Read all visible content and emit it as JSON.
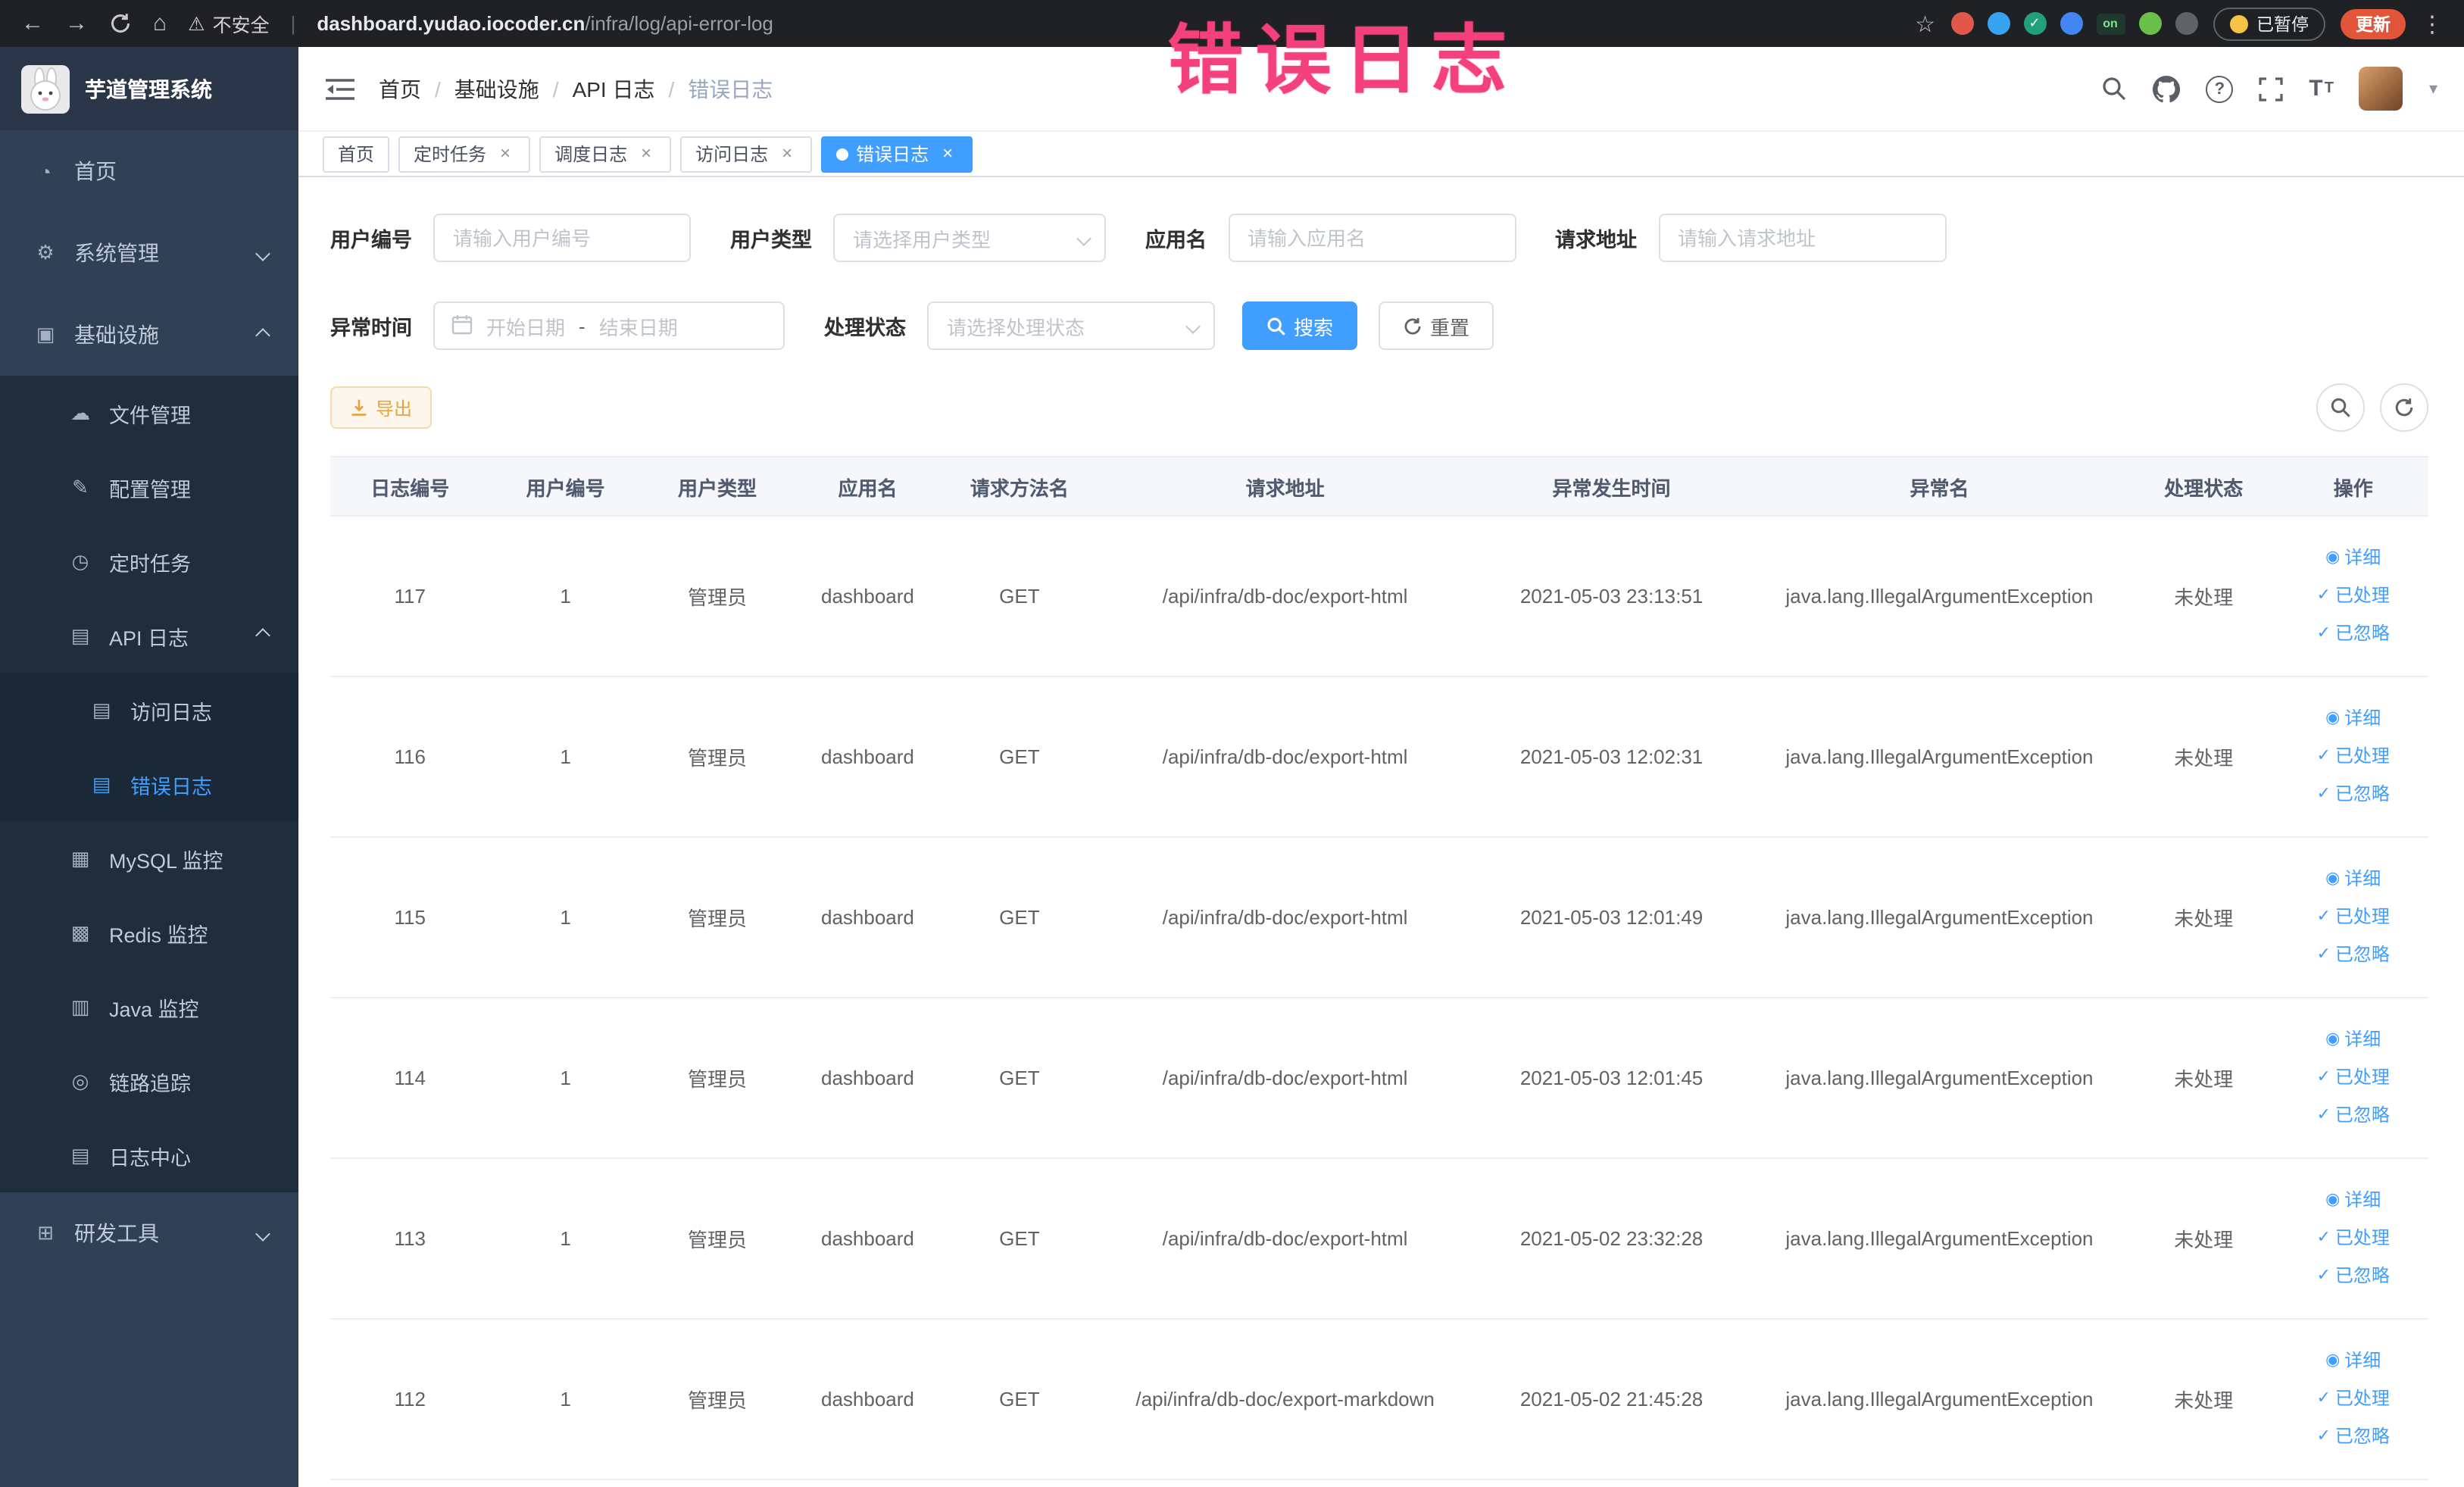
{
  "browser": {
    "security": "不安全",
    "url_host": "dashboard.yudao.iocoder.cn",
    "url_path": "/infra/log/api-error-log",
    "extensions": [
      {
        "name": "extension-orange-shield",
        "color": "#e2574c"
      },
      {
        "name": "extension-blue-drop",
        "color": "#38a3f1"
      },
      {
        "name": "extension-green-check",
        "color": "#21a179",
        "glyph": "✓"
      },
      {
        "name": "extension-blue-grid",
        "color": "#4285f4"
      },
      {
        "name": "extension-toggle-on",
        "color": "#1e3a2f",
        "glyph": "on"
      },
      {
        "name": "extension-leaf",
        "color": "#6abf4b"
      },
      {
        "name": "extension-puzzle",
        "color": "#5f6368"
      }
    ],
    "paused": "已暂停",
    "update": "更新",
    "update_color": "#e25538"
  },
  "annotation": {
    "text": "错误日志",
    "color": "#f4417c"
  },
  "sidebar": {
    "title": "芋道管理系统",
    "items": [
      {
        "id": "home",
        "label": "首页",
        "icon": "gauge",
        "level": 1
      },
      {
        "id": "system",
        "label": "系统管理",
        "icon": "gear",
        "level": 1,
        "chevron": "down"
      },
      {
        "id": "infrastructure",
        "label": "基础设施",
        "icon": "monitor",
        "level": 1,
        "chevron": "up"
      },
      {
        "id": "file-manage",
        "label": "文件管理",
        "icon": "cloud",
        "level": 2
      },
      {
        "id": "config-manage",
        "label": "配置管理",
        "icon": "edit",
        "level": 2
      },
      {
        "id": "scheduled-job",
        "label": "定时任务",
        "icon": "timer",
        "level": 2
      },
      {
        "id": "api-log",
        "label": "API 日志",
        "icon": "doc",
        "level": 2,
        "chevron": "up"
      },
      {
        "id": "access-log",
        "label": "访问日志",
        "icon": "doc",
        "level": 3
      },
      {
        "id": "error-log",
        "label": "错误日志",
        "icon": "doc",
        "level": 3,
        "active": true
      },
      {
        "id": "mysql-monitor",
        "label": "MySQL 监控",
        "icon": "grid",
        "level": 2
      },
      {
        "id": "redis-monitor",
        "label": "Redis 监控",
        "icon": "layers",
        "level": 2
      },
      {
        "id": "java-monitor",
        "label": "Java 监控",
        "icon": "screen",
        "level": 2
      },
      {
        "id": "tracer",
        "label": "链路追踪",
        "icon": "eye",
        "level": 2
      },
      {
        "id": "log-center",
        "label": "日志中心",
        "icon": "doc",
        "level": 2
      },
      {
        "id": "dev-tools",
        "label": "研发工具",
        "icon": "tools",
        "level": 1,
        "chevron": "down"
      }
    ]
  },
  "header": {
    "breadcrumb": [
      "首页",
      "基础设施",
      "API 日志",
      "错误日志"
    ]
  },
  "tabs": [
    {
      "id": "home",
      "label": "首页",
      "closable": false,
      "active": false
    },
    {
      "id": "scheduled-job",
      "label": "定时任务",
      "closable": true,
      "active": false
    },
    {
      "id": "job-log",
      "label": "调度日志",
      "closable": true,
      "active": false
    },
    {
      "id": "access-log",
      "label": "访问日志",
      "closable": true,
      "active": false
    },
    {
      "id": "error-log",
      "label": "错误日志",
      "closable": true,
      "active": true
    }
  ],
  "filters": {
    "user_id": {
      "label": "用户编号",
      "placeholder": "请输入用户编号"
    },
    "user_type": {
      "label": "用户类型",
      "placeholder": "请选择用户类型"
    },
    "app_name": {
      "label": "应用名",
      "placeholder": "请输入应用名"
    },
    "request_url": {
      "label": "请求地址",
      "placeholder": "请输入请求地址"
    },
    "exception_time": {
      "label": "异常时间",
      "start": "开始日期",
      "separator": "-",
      "end": "结束日期"
    },
    "process_status": {
      "label": "处理状态",
      "placeholder": "请选择处理状态"
    },
    "search": "搜索",
    "reset": "重置"
  },
  "toolbar": {
    "export": "导出"
  },
  "table": {
    "columns": [
      "日志编号",
      "用户编号",
      "用户类型",
      "应用名",
      "请求方法名",
      "请求地址",
      "异常发生时间",
      "异常名",
      "处理状态",
      "操作"
    ],
    "actions": [
      "详细",
      "已处理",
      "已忽略"
    ],
    "rows": [
      {
        "id": "117",
        "user_id": "1",
        "user_type": "管理员",
        "app": "dashboard",
        "method": "GET",
        "url": "/api/infra/db-doc/export-html",
        "time": "2021-05-03 23:13:51",
        "exception": "java.lang.IllegalArgumentException",
        "status": "未处理"
      },
      {
        "id": "116",
        "user_id": "1",
        "user_type": "管理员",
        "app": "dashboard",
        "method": "GET",
        "url": "/api/infra/db-doc/export-html",
        "time": "2021-05-03 12:02:31",
        "exception": "java.lang.IllegalArgumentException",
        "status": "未处理"
      },
      {
        "id": "115",
        "user_id": "1",
        "user_type": "管理员",
        "app": "dashboard",
        "method": "GET",
        "url": "/api/infra/db-doc/export-html",
        "time": "2021-05-03 12:01:49",
        "exception": "java.lang.IllegalArgumentException",
        "status": "未处理"
      },
      {
        "id": "114",
        "user_id": "1",
        "user_type": "管理员",
        "app": "dashboard",
        "method": "GET",
        "url": "/api/infra/db-doc/export-html",
        "time": "2021-05-03 12:01:45",
        "exception": "java.lang.IllegalArgumentException",
        "status": "未处理"
      },
      {
        "id": "113",
        "user_id": "1",
        "user_type": "管理员",
        "app": "dashboard",
        "method": "GET",
        "url": "/api/infra/db-doc/export-html",
        "time": "2021-05-02 23:32:28",
        "exception": "java.lang.IllegalArgumentException",
        "status": "未处理"
      },
      {
        "id": "112",
        "user_id": "1",
        "user_type": "管理员",
        "app": "dashboard",
        "method": "GET",
        "url": "/api/infra/db-doc/export-markdown",
        "time": "2021-05-02 21:45:28",
        "exception": "java.lang.IllegalArgumentException",
        "status": "未处理"
      }
    ]
  },
  "colors": {
    "accent": "#409eff",
    "warning": "#e6a23c",
    "sidebar_bg": "#304156",
    "submenu_bg": "#1f2d3d"
  }
}
